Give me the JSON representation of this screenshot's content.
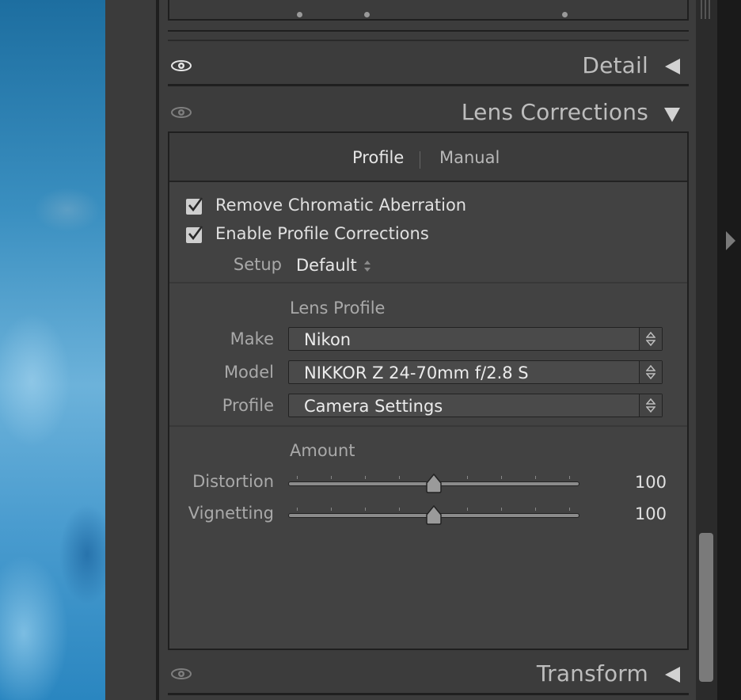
{
  "panel": {
    "sections": {
      "detail": {
        "title": "Detail"
      },
      "lens_corrections": {
        "title": "Lens Corrections",
        "tabs": [
          {
            "label": "Profile",
            "active": true
          },
          {
            "label": "Manual",
            "active": false
          }
        ],
        "checkboxes": [
          {
            "label": "Remove Chromatic Aberration",
            "checked": true
          },
          {
            "label": "Enable Profile Corrections",
            "checked": true
          }
        ],
        "setup": {
          "label": "Setup",
          "value": "Default"
        },
        "lens_profile": {
          "title": "Lens Profile",
          "make": {
            "label": "Make",
            "value": "Nikon"
          },
          "model": {
            "label": "Model",
            "value": "NIKKOR Z 24-70mm f/2.8 S"
          },
          "profile": {
            "label": "Profile",
            "value": "Camera Settings"
          }
        },
        "amount": {
          "title": "Amount",
          "distortion": {
            "label": "Distortion",
            "value": "100",
            "level": 0.5
          },
          "vignetting": {
            "label": "Vignetting",
            "value": "100",
            "level": 0.5
          }
        }
      },
      "transform": {
        "title": "Transform"
      }
    }
  },
  "icons": {
    "eye": "eye-icon",
    "collapsed": "triangle-left-icon",
    "expanded": "triangle-down-icon",
    "updown": "updown-arrows-icon",
    "side_arrow": "panel-collapse-arrow-icon"
  },
  "colors": {
    "panel_bg": "#3c3c3c",
    "border": "#1f1f1f",
    "text": "#e0e0e0",
    "label": "#a9a9a9"
  }
}
